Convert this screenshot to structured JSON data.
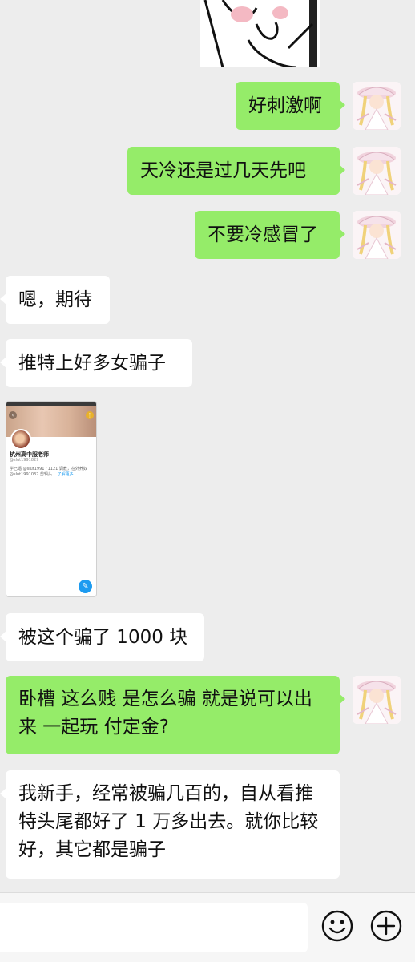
{
  "messages": [
    {
      "side": "out",
      "text": "好刺激啊"
    },
    {
      "side": "out",
      "text": "天冷还是过几天先吧"
    },
    {
      "side": "out",
      "text": "不要冷感冒了"
    },
    {
      "side": "in",
      "text": "嗯，期待"
    },
    {
      "side": "in",
      "text": "推特上好多女骗子"
    },
    {
      "side": "in",
      "text": "被这个骗了 1000 块"
    },
    {
      "side": "out",
      "text": "卧槽 这么贱 是怎么骗 就是说可以出来 一起玩 付定金?"
    },
    {
      "side": "in",
      "text": "我新手，经常被骗几百的，自从看推特头尾都好了 1 万多出去。就你比较好，其它都是骗子"
    }
  ],
  "screenshot": {
    "name": "杭州高中服老师",
    "handle": "@slut1991829",
    "bio_text": "学已婚 @slut1991 “1121 调教，在外养奴 @slut1991037 剪辑头… ",
    "bio_link": "了解更多"
  },
  "icons": {
    "emoji": "smiley-face-icon",
    "more": "plus-circle-icon"
  },
  "colors": {
    "background": "#ededed",
    "outgoing_bubble": "#95ec69",
    "incoming_bubble": "#ffffff"
  }
}
